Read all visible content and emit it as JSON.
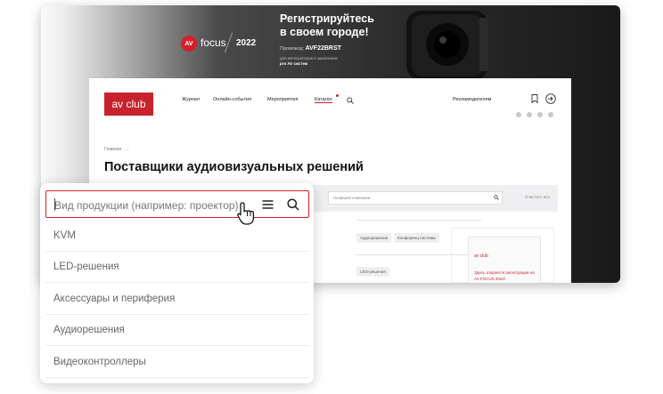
{
  "banner": {
    "brand_av": "AV",
    "brand_focus": "focus",
    "brand_year": "2022",
    "title_line1": "Регистрируйтесь",
    "title_line2": "в своем городе!",
    "promo_label": "Промокод:",
    "promo_code": "AVF22BRST",
    "small_line1": "для интеграторов и заказчиков",
    "small_line2": "pro AV систем"
  },
  "site": {
    "logo": "av club",
    "nav": [
      "Журнал",
      "Онлайн-события",
      "Мероприятия",
      "Каталог"
    ],
    "advertisers": "Рекламодателям",
    "breadcrumb": "Главная",
    "page_title": "Поставщики аудиовизуальных решений",
    "filter_placeholder": "Название компании",
    "reset_label": "Очистить все",
    "chips": [
      "Аудиорешения",
      "Конференц-системы",
      "LED-решения"
    ],
    "side_logo": "av club",
    "side_text": "Здесь откроется регистрация на AV FOCUS 2022!"
  },
  "popup": {
    "search_placeholder": "Вид продукции (например: проектор)",
    "options": [
      "KVM",
      "LED-решения",
      "Аксессуары и периферия",
      "Аудиорешения",
      "Видеоконтроллеры"
    ]
  },
  "colors": {
    "accent": "#d5202b",
    "logo_bg": "#c8232c",
    "filter_bg": "#efeff1"
  }
}
